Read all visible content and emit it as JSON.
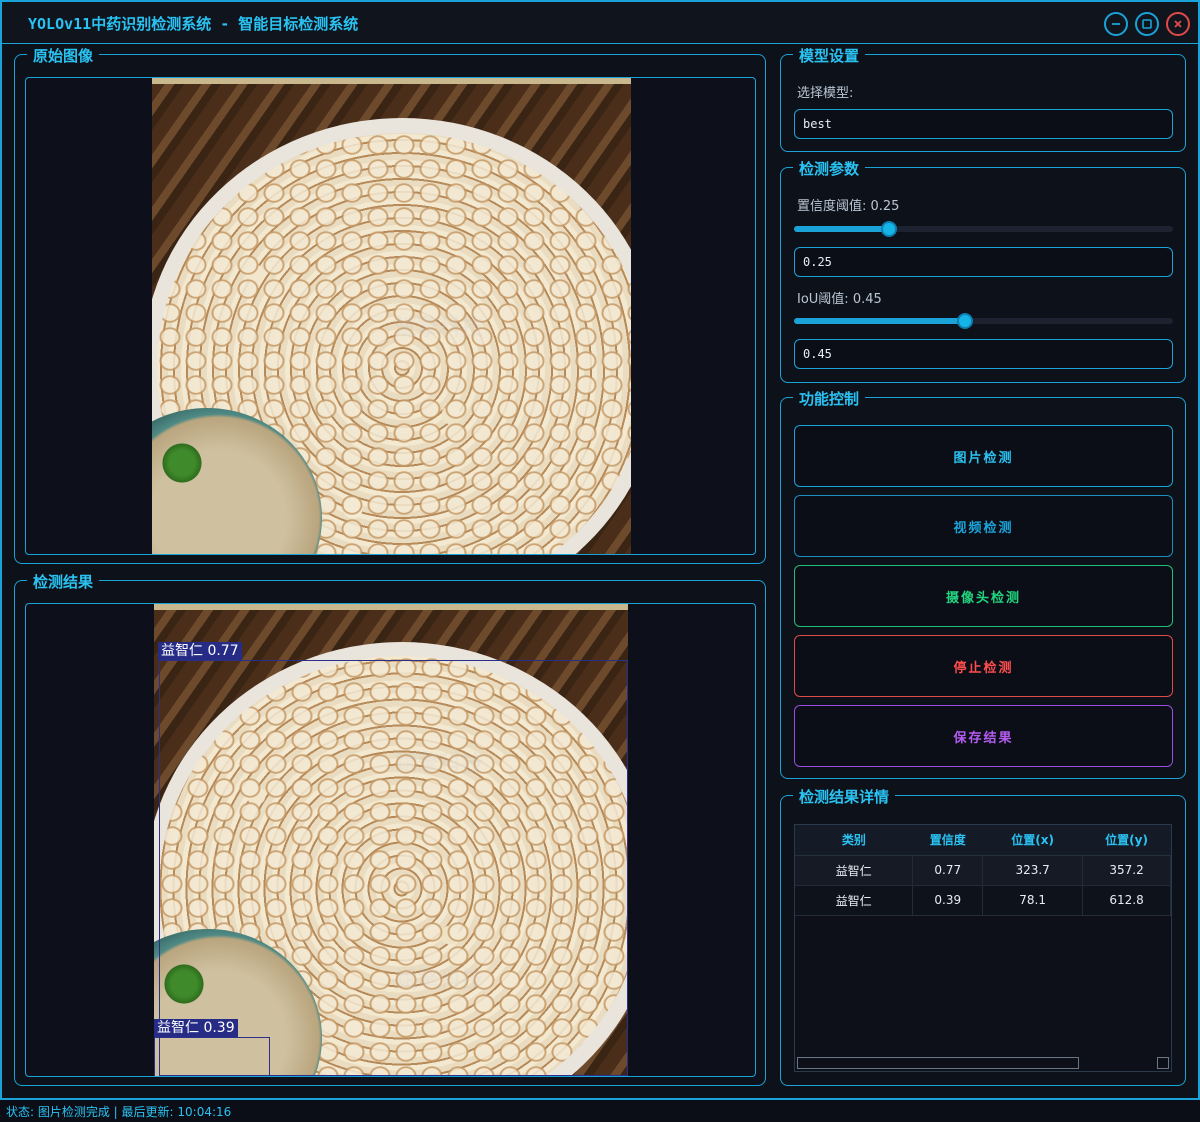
{
  "window": {
    "title": "YOLOv11中药识别检测系统 - 智能目标检测系统"
  },
  "panels": {
    "original_title": "原始图像",
    "result_title": "检测结果",
    "model_title": "模型设置",
    "params_title": "检测参数",
    "control_title": "功能控制",
    "details_title": "检测结果详情"
  },
  "model": {
    "label": "选择模型:",
    "selected": "best"
  },
  "params": {
    "conf_label": "置信度阈值: 0.25",
    "conf_value": "0.25",
    "conf_fraction": 0.25,
    "iou_label": "IoU阈值: 0.45",
    "iou_value": "0.45",
    "iou_fraction": 0.45
  },
  "controls": {
    "image_detect": "图片检测",
    "video_detect": "视频检测",
    "camera_detect": "摄像头检测",
    "stop_detect": "停止检测",
    "save_result": "保存结果"
  },
  "colors": {
    "accent": "#1aa3d8",
    "image_btn": "#1aa3d8",
    "video_btn": "#1aa3d8",
    "camera_btn": "#1fbf7a",
    "stop_btn": "#e24a4a",
    "save_btn": "#9b4de0"
  },
  "detections": {
    "label_1": "益智仁 0.77",
    "label_2": "益智仁 0.39"
  },
  "table": {
    "headers": [
      "类别",
      "置信度",
      "位置(x)",
      "位置(y)"
    ],
    "rows": [
      [
        "益智仁",
        "0.77",
        "323.7",
        "357.2"
      ],
      [
        "益智仁",
        "0.39",
        "78.1",
        "612.8"
      ]
    ]
  },
  "watermark": "斌擎科技",
  "status": {
    "text": "状态: 图片检测完成 | 最后更新: 10:04:16"
  }
}
